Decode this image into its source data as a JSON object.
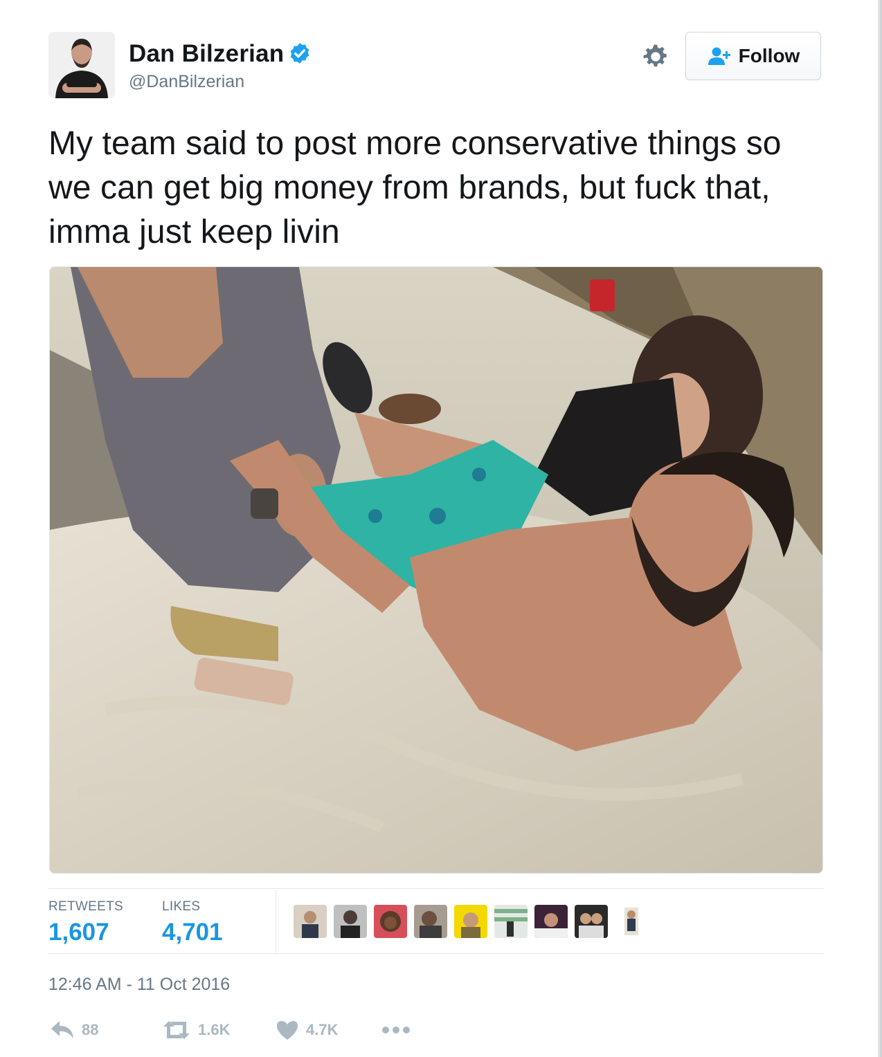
{
  "author": {
    "display_name": "Dan Bilzerian",
    "username": "@DanBilzerian",
    "verified": true
  },
  "header": {
    "follow_label": "Follow",
    "follow_icon": "user-add-icon",
    "settings_icon": "gear-icon"
  },
  "tweet": {
    "text": "My team said to post more conservative things so we can get big money from brands, but fuck that, imma just keep livin",
    "timestamp": "12:46 AM - 11 Oct 2016"
  },
  "stats": {
    "retweets_label": "RETWEETS",
    "retweets_value": "1,607",
    "likes_label": "LIKES",
    "likes_value": "4,701",
    "liker_avatar_count": 9
  },
  "actions": {
    "reply_count": "88",
    "retweet_count": "1.6K",
    "like_count": "4.7K",
    "reply_icon": "reply-icon",
    "retweet_icon": "retweet-icon",
    "like_icon": "heart-icon",
    "more_icon": "more-icon"
  },
  "colors": {
    "link_blue": "#1b95e0",
    "verified_blue": "#1da1f2",
    "muted_gray": "#657786",
    "action_gray": "#aab8c2"
  }
}
